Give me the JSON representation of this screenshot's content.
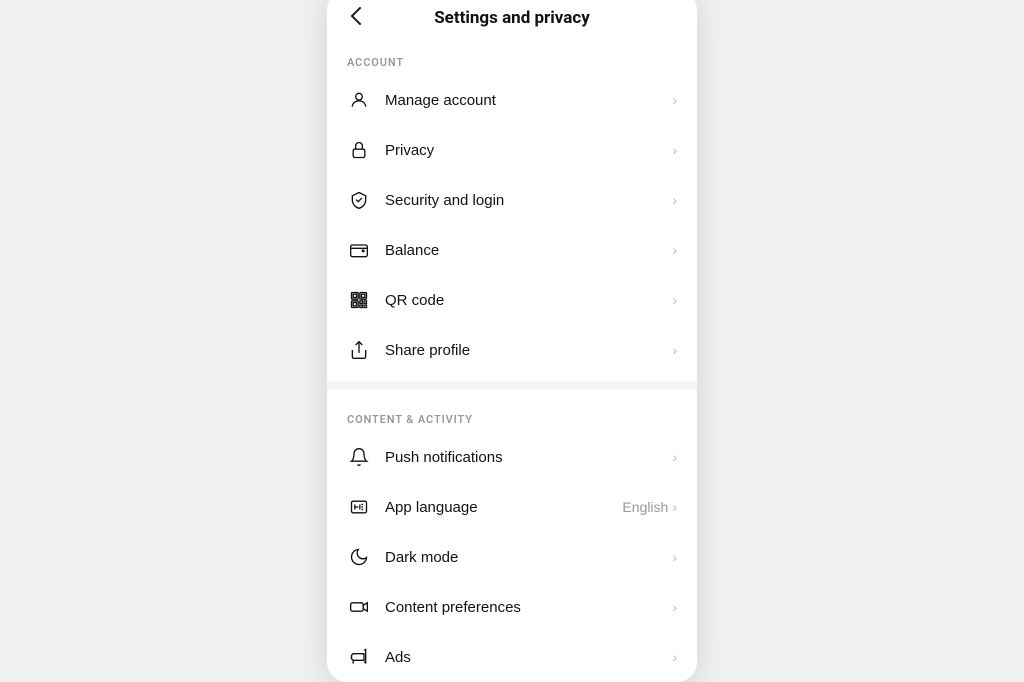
{
  "header": {
    "title": "Settings and privacy",
    "back_label": "‹"
  },
  "sections": [
    {
      "id": "account",
      "label": "ACCOUNT",
      "items": [
        {
          "id": "manage-account",
          "label": "Manage account",
          "icon": "user",
          "value": "",
          "chevron": true
        },
        {
          "id": "privacy",
          "label": "Privacy",
          "icon": "lock",
          "value": "",
          "chevron": true
        },
        {
          "id": "security-login",
          "label": "Security and login",
          "icon": "shield",
          "value": "",
          "chevron": true
        },
        {
          "id": "balance",
          "label": "Balance",
          "icon": "wallet",
          "value": "",
          "chevron": true
        },
        {
          "id": "qr-code",
          "label": "QR code",
          "icon": "qrcode",
          "value": "",
          "chevron": true
        },
        {
          "id": "share-profile",
          "label": "Share profile",
          "icon": "share",
          "value": "",
          "chevron": true
        }
      ]
    },
    {
      "id": "content-activity",
      "label": "CONTENT & ACTIVITY",
      "items": [
        {
          "id": "push-notifications",
          "label": "Push notifications",
          "icon": "bell",
          "value": "",
          "chevron": true
        },
        {
          "id": "app-language",
          "label": "App language",
          "icon": "language",
          "value": "English",
          "chevron": true
        },
        {
          "id": "dark-mode",
          "label": "Dark mode",
          "icon": "moon",
          "value": "",
          "chevron": true
        },
        {
          "id": "content-preferences",
          "label": "Content preferences",
          "icon": "video",
          "value": "",
          "chevron": true
        },
        {
          "id": "ads",
          "label": "Ads",
          "icon": "megaphone",
          "value": "",
          "chevron": true
        }
      ]
    }
  ]
}
